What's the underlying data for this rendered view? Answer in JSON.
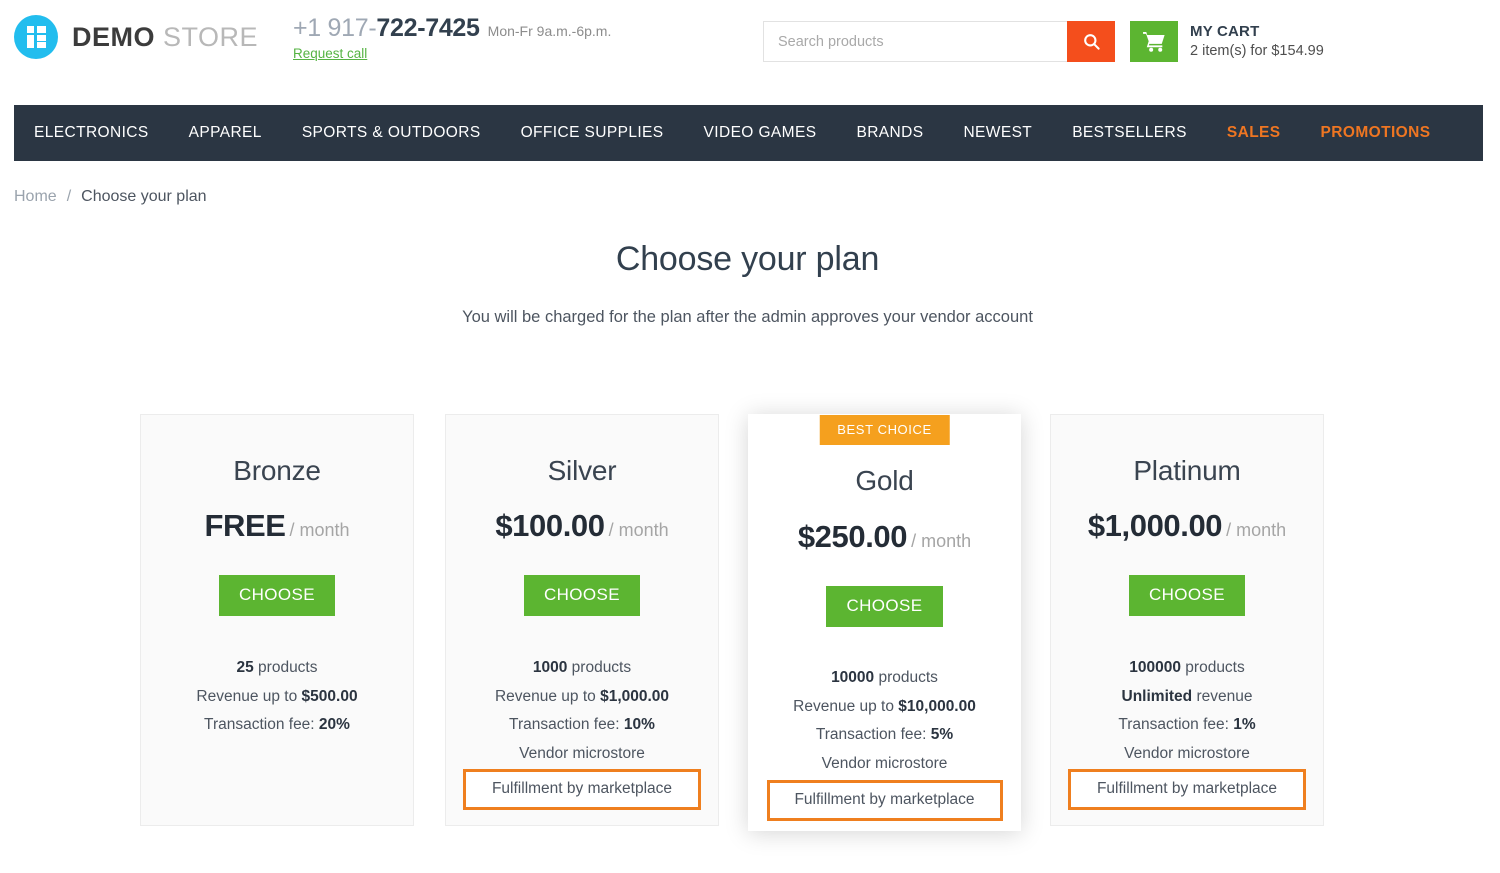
{
  "header": {
    "logo": {
      "bold": "DEMO",
      "light": "STORE",
      "icon": "grid-squares-logo-icon"
    },
    "phone": {
      "prefix": "+1 917-",
      "main": "722-7425",
      "hours": "Mon-Fr 9a.m.-6p.m.",
      "request_call": "Request call"
    },
    "search": {
      "placeholder": "Search products",
      "value": "",
      "icon": "search-icon"
    },
    "cart": {
      "icon": "shopping-cart-icon",
      "title": "MY CART",
      "summary": "2 item(s) for $154.99"
    }
  },
  "nav": {
    "items": [
      {
        "label": "ELECTRONICS",
        "accent": false
      },
      {
        "label": "APPAREL",
        "accent": false
      },
      {
        "label": "SPORTS & OUTDOORS",
        "accent": false
      },
      {
        "label": "OFFICE SUPPLIES",
        "accent": false
      },
      {
        "label": "VIDEO GAMES",
        "accent": false
      },
      {
        "label": "BRANDS",
        "accent": false
      },
      {
        "label": "NEWEST",
        "accent": false
      },
      {
        "label": "BESTSELLERS",
        "accent": false
      },
      {
        "label": "SALES",
        "accent": true
      },
      {
        "label": "PROMOTIONS",
        "accent": true
      }
    ]
  },
  "breadcrumb": {
    "home": "Home",
    "separator": "/",
    "current": "Choose your plan"
  },
  "page": {
    "title": "Choose your plan",
    "subtitle": "You will be charged for the plan after the admin approves your vendor account"
  },
  "colors": {
    "nav_bg": "#2b3643",
    "accent_orange": "#ef7622",
    "search_btn": "#f44e1c",
    "green": "#5cb531",
    "badge_orange": "#f5a01e",
    "highlight_border": "#ef7f1f",
    "logo_cyan": "#22bdee"
  },
  "plans": [
    {
      "name": "Bronze",
      "price": "FREE",
      "per": "/ month",
      "button": "CHOOSE",
      "best_choice": false,
      "badge_label": "",
      "features": [
        {
          "strong": "25",
          "text": " products",
          "highlighted": false
        },
        {
          "strong": "",
          "text": "Revenue up to ",
          "strong_after": "$500.00",
          "highlighted": false
        },
        {
          "strong": "",
          "text": "Transaction fee: ",
          "strong_after": "20%",
          "highlighted": false
        }
      ]
    },
    {
      "name": "Silver",
      "price": "$100.00",
      "per": "/ month",
      "button": "CHOOSE",
      "best_choice": false,
      "badge_label": "",
      "features": [
        {
          "strong": "1000",
          "text": " products",
          "highlighted": false
        },
        {
          "strong": "",
          "text": "Revenue up to ",
          "strong_after": "$1,000.00",
          "highlighted": false
        },
        {
          "strong": "",
          "text": "Transaction fee: ",
          "strong_after": "10%",
          "highlighted": false
        },
        {
          "strong": "",
          "text": "Vendor microstore",
          "strong_after": "",
          "highlighted": false
        },
        {
          "strong": "",
          "text": "Fulfillment by marketplace",
          "strong_after": "",
          "highlighted": true
        }
      ]
    },
    {
      "name": "Gold",
      "price": "$250.00",
      "per": "/ month",
      "button": "CHOOSE",
      "best_choice": true,
      "badge_label": "BEST CHOICE",
      "features": [
        {
          "strong": "10000",
          "text": " products",
          "highlighted": false
        },
        {
          "strong": "",
          "text": "Revenue up to ",
          "strong_after": "$10,000.00",
          "highlighted": false
        },
        {
          "strong": "",
          "text": "Transaction fee: ",
          "strong_after": "5%",
          "highlighted": false
        },
        {
          "strong": "",
          "text": "Vendor microstore",
          "strong_after": "",
          "highlighted": false
        },
        {
          "strong": "",
          "text": "Fulfillment by marketplace",
          "strong_after": "",
          "highlighted": true
        }
      ]
    },
    {
      "name": "Platinum",
      "price": "$1,000.00",
      "per": "/ month",
      "button": "CHOOSE",
      "best_choice": false,
      "badge_label": "",
      "features": [
        {
          "strong": "100000",
          "text": " products",
          "highlighted": false
        },
        {
          "strong": "Unlimited",
          "text": " revenue",
          "highlighted": false
        },
        {
          "strong": "",
          "text": "Transaction fee: ",
          "strong_after": "1%",
          "highlighted": false
        },
        {
          "strong": "",
          "text": "Vendor microstore",
          "strong_after": "",
          "highlighted": false
        },
        {
          "strong": "",
          "text": "Fulfillment by marketplace",
          "strong_after": "",
          "highlighted": true
        }
      ]
    }
  ]
}
